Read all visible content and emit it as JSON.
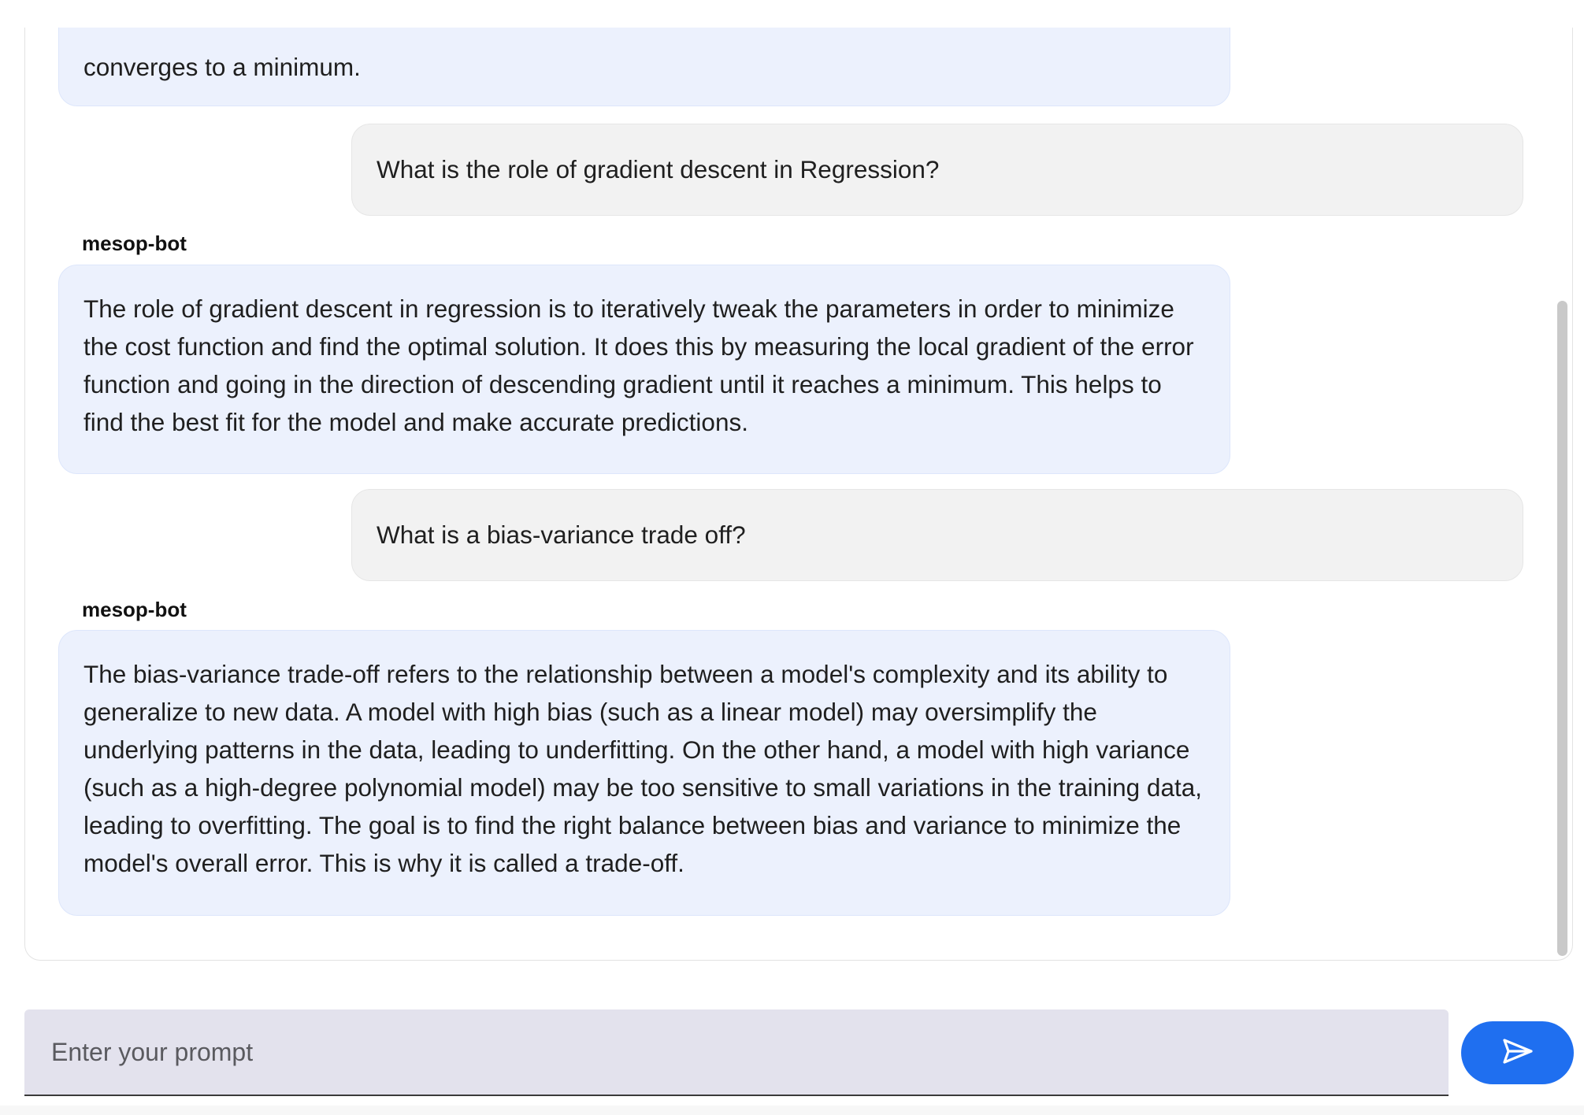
{
  "messages": [
    {
      "role": "bot",
      "text": "converges to a minimum."
    },
    {
      "role": "user",
      "text": "What is the role of gradient descent in Regression?"
    },
    {
      "role": "bot",
      "name": "mesop-bot",
      "text": "The role of gradient descent in regression is to iteratively tweak the parameters in order to minimize the cost function and find the optimal solution. It does this by measuring the local gradient of the error function and going in the direction of descending gradient until it reaches a minimum. This helps to find the best fit for the model and make accurate predictions."
    },
    {
      "role": "user",
      "text": "What is a bias-variance trade off?"
    },
    {
      "role": "bot",
      "name": "mesop-bot",
      "text": "The bias-variance trade-off refers to the relationship between a model's complexity and its ability to generalize to new data. A model with high bias (such as a linear model) may oversimplify the underlying patterns in the data, leading to underfitting. On the other hand, a model with high variance (such as a high-degree polynomial model) may be too sensitive to small variations in the training data, leading to overfitting. The goal is to find the right balance between bias and variance to minimize the model's overall error. This is why it is called a trade-off."
    }
  ],
  "prompt": {
    "placeholder": "Enter your prompt",
    "value": ""
  },
  "send_button": {
    "icon": "send-icon",
    "color": "#1f6ff0"
  },
  "colors": {
    "bot_bubble": "#ecf1fd",
    "user_bubble": "#f2f2f2",
    "prompt_background": "#e3e2ed"
  }
}
